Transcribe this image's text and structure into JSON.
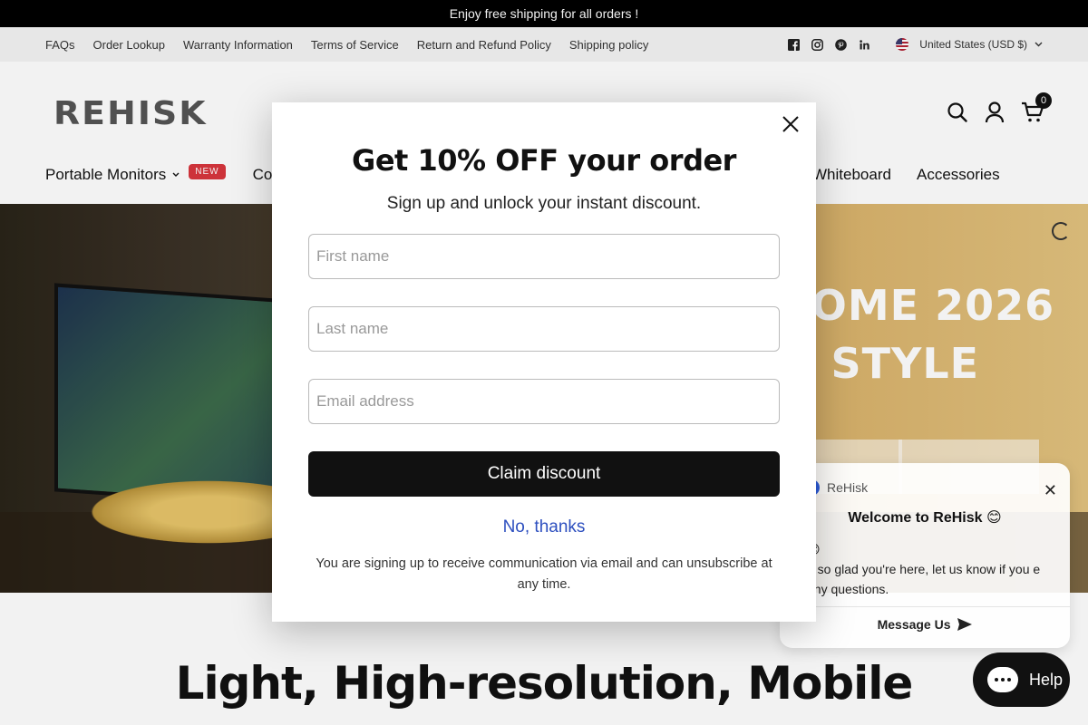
{
  "announcement": "Enjoy free shipping for all orders !",
  "utility_links": [
    "FAQs",
    "Order Lookup",
    "Warranty Information",
    "Terms of Service",
    "Return and Refund Policy",
    "Shipping policy"
  ],
  "social_icons": [
    "facebook-icon",
    "instagram-icon",
    "pinterest-icon",
    "linkedin-icon"
  ],
  "country_selector": "United States (USD $)",
  "logo_text": "REHISK",
  "cart_count": "0",
  "nav": {
    "portable_monitors": "Portable Monitors",
    "new_badge": "NEW",
    "co_partial": "Co",
    "whiteboard": "Whiteboard",
    "accessories": "Accessories"
  },
  "hero": {
    "line1": "COME 2026",
    "line2": "N STYLE"
  },
  "section_title": "Light, High-resolution, Mobile",
  "modal": {
    "title": "Get 10% OFF your order",
    "subtitle": "Sign up and unlock your instant discount.",
    "first_name_placeholder": "First name",
    "last_name_placeholder": "Last name",
    "email_placeholder": "Email address",
    "claim_label": "Claim discount",
    "decline_label": "No, thanks",
    "legal": "You are signing up to receive communication via email and can unsubscribe at any time."
  },
  "chat": {
    "brand": "ReHisk",
    "welcome": "Welcome to ReHisk 😊",
    "emoji_line": "😊",
    "message": "e so glad you're here, let us know if you e any questions.",
    "send_label": "Message Us"
  },
  "help_label": "Help",
  "colors": {
    "accent_link": "#2d4fbf",
    "badge_red": "#d9363e",
    "primary": "#111111"
  }
}
